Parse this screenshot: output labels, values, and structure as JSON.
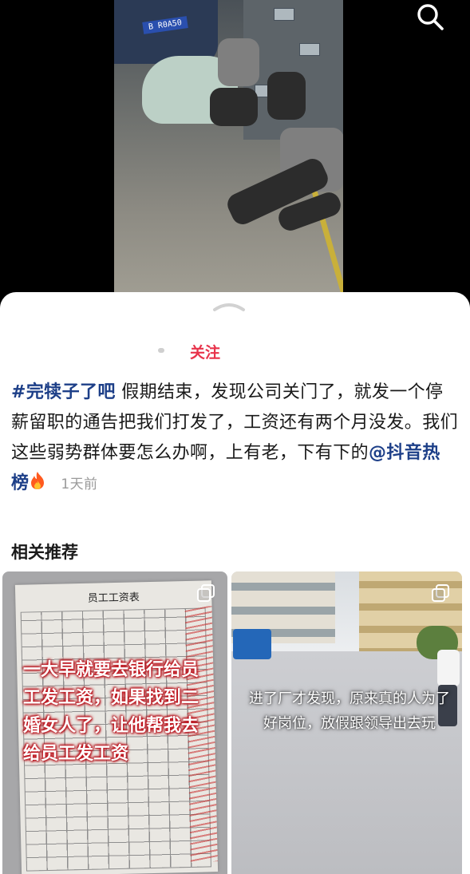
{
  "video": {
    "car_plate": "B R0A50",
    "search_icon": "search-icon"
  },
  "post": {
    "follow_label": "关注",
    "hashtag": "#完犊子了吧",
    "text": " 假期结束，发现公司关门了，就发一个停薪留职的通告把我们打发了，工资还有两个月没发。我们这些弱势群体要怎么办啊，上有老，下有下的",
    "mention": "@抖音热榜",
    "fire_icon": "fire-icon",
    "time_ago": "1天前"
  },
  "related": {
    "title": "相关推荐",
    "cards": [
      {
        "paper_title": "员工工资表",
        "overlay_text": "一大早就要去银行给员工发工资，如果找到二婚女人了，让他帮我去给员工发工资",
        "icon": "multi-image-icon"
      },
      {
        "overlay_text": "进了厂才发现，原来真的人为了好岗位，放假跟领导出去玩",
        "icon": "multi-image-icon"
      }
    ]
  },
  "colors": {
    "follow": "#e8334b",
    "link": "#1d3f88",
    "overlay_red": "#c4141e"
  }
}
